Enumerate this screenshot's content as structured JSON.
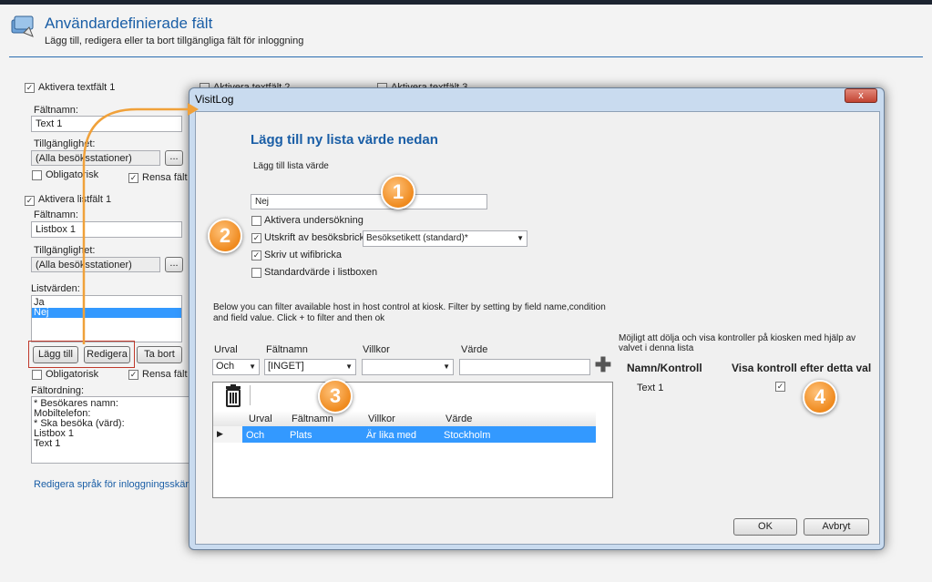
{
  "page": {
    "title": "Användardefinierade fält",
    "subtitle": "Lägg till, redigera eller ta bort tillgängliga fält för inloggning"
  },
  "left": {
    "activate_text1": "Aktivera textfält 1",
    "activate_text2": "Aktivera textfält 2",
    "activate_text3": "Aktivera textfält 3",
    "faltnamn_label": "Fältnamn:",
    "text1_value": "Text 1",
    "tillganglighet_label": "Tillgänglighet:",
    "all_stations": "(Alla besöksstationer)",
    "browse": "...",
    "obligatorisk": "Obligatorisk",
    "rensa_falt": "Rensa fält",
    "activate_list1": "Aktivera listfält 1",
    "listbox_value": "Listbox 1",
    "listvarden_label": "Listvärden:",
    "list_items": [
      "Ja",
      "Nej"
    ],
    "add_btn": "Lägg till",
    "edit_btn": "Redigera",
    "delete_btn": "Ta bort",
    "faltordning_label": "Fältordning:",
    "order_items": [
      "* Besökares namn:",
      "Mobiltelefon:",
      "* Ska besöka (värd):",
      "Listbox 1",
      "Text 1"
    ],
    "edit_lang_link": "Redigera språk för inloggningsskärm"
  },
  "dialog": {
    "title": "VisitLog",
    "close": "x",
    "heading": "Lägg till ny lista värde nedan",
    "add_value_label": "Lägg till lista värde",
    "value_input": "Nej",
    "opt_survey": "Aktivera undersökning",
    "opt_print": "Utskrift av besöksbricka",
    "print_template": "Besöksetikett (standard)*",
    "opt_wifi": "Skriv ut wifibricka",
    "opt_default": "Standardvärde i listboxen",
    "filter_desc": "Below you can filter available host in host control at kiosk. Filter by setting by field name,condition and field value. Click + to filter and then ok",
    "filter_labels": {
      "urval": "Urval",
      "faltnamn": "Fältnamn",
      "villkor": "Villkor",
      "varde": "Värde"
    },
    "filter_values": {
      "urval": "Och",
      "faltnamn": "[INGET]",
      "villkor": "",
      "varde": ""
    },
    "grid_headers": [
      "Urval",
      "Fältnamn",
      "Villkor",
      "Värde"
    ],
    "grid_rows": [
      [
        "Och",
        "Plats",
        "Är lika med",
        "Stockholm"
      ]
    ],
    "right_desc": "Möjligt att dölja och visa kontroller på kiosken med hjälp av valvet i denna lista",
    "col_namn": "Namn/Kontroll",
    "col_visa": "Visa kontroll efter detta val",
    "ctrl_text1": "Text 1",
    "ok": "OK",
    "cancel": "Avbryt"
  },
  "badges": [
    "1",
    "2",
    "3",
    "4"
  ],
  "colors": {
    "accent": "#1a5ea6",
    "selection": "#3399ff",
    "badge": "#ef8a1e",
    "arrow": "#f0a13a"
  }
}
